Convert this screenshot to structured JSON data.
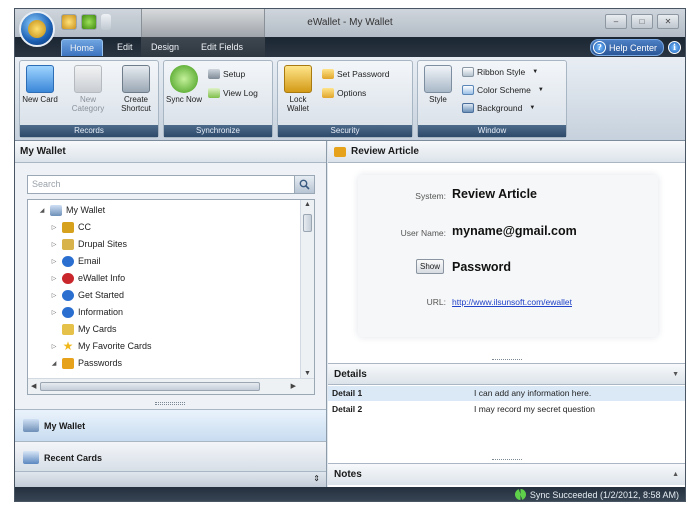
{
  "window": {
    "title": "eWallet - My Wallet",
    "context_tab_title": ""
  },
  "ribbon_tabs": [
    {
      "label": "Home"
    },
    {
      "label": "Edit"
    },
    {
      "label": "Design"
    },
    {
      "label": "Edit Fields"
    }
  ],
  "help_center_label": "Help Center",
  "ribbon": {
    "records": {
      "label": "Records",
      "new_card": "New Card",
      "new_category": "New Category",
      "create_shortcut": "Create Shortcut"
    },
    "synchronize": {
      "label": "Synchronize",
      "sync_now": "Sync Now",
      "setup": "Setup",
      "view_log": "View Log"
    },
    "security": {
      "label": "Security",
      "lock_wallet": "Lock Wallet",
      "set_password": "Set Password",
      "options": "Options"
    },
    "window_group": {
      "label": "Window",
      "style": "Style",
      "ribbon_style": "Ribbon Style",
      "color_scheme": "Color Scheme",
      "background": "Background"
    }
  },
  "left_pane": {
    "title": "My Wallet",
    "search_placeholder": "Search",
    "tree": [
      {
        "label": "My Wallet",
        "icon": "wallet-icon",
        "color": "#6e8fb8"
      },
      {
        "label": "CC",
        "icon": "cc-folder-icon",
        "color": "#d6a21e"
      },
      {
        "label": "Drupal Sites",
        "icon": "folder-icon",
        "color": "#d8b24a"
      },
      {
        "label": "Email",
        "icon": "info-icon",
        "color": "#2a6fd0"
      },
      {
        "label": "eWallet Info",
        "icon": "ewallet-info-icon",
        "color": "#c8262a"
      },
      {
        "label": "Get Started",
        "icon": "info-icon",
        "color": "#2a6fd0"
      },
      {
        "label": "Information",
        "icon": "info-icon",
        "color": "#2a6fd0"
      },
      {
        "label": "My Cards",
        "icon": "folder-icon",
        "color": "#e5c14a"
      },
      {
        "label": "My Favorite Cards",
        "icon": "star-icon",
        "color": "#f0b81c"
      },
      {
        "label": "Passwords",
        "icon": "key-icon",
        "color": "#e6a21a"
      }
    ],
    "nav_buttons": [
      {
        "label": "My Wallet"
      },
      {
        "label": "Recent Cards"
      }
    ]
  },
  "right_pane": {
    "title": "Review Article",
    "card": {
      "system_label": "System:",
      "system_value": "Review Article",
      "username_label": "User Name:",
      "username_value": "myname@gmail.com",
      "show_button": "Show",
      "password_value": "Password",
      "url_label": "URL:",
      "url_value": "http://www.ilsunsoft.com/ewallet"
    },
    "details": {
      "title": "Details",
      "rows": [
        {
          "name": "Detail 1",
          "value": "I can add any information here."
        },
        {
          "name": "Detail 2",
          "value": "I may record my secret question"
        }
      ]
    },
    "notes": {
      "title": "Notes"
    }
  },
  "statusbar": {
    "text": "Sync Succeeded (1/2/2012, 8:58 AM)"
  }
}
